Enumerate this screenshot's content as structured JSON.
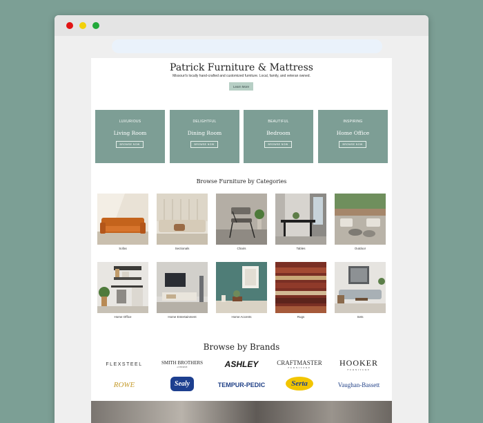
{
  "hero": {
    "title": "Patrick Furniture & Mattress",
    "subtitle": "Missouri's locally hand-crafted and customized furniture. Local, family, and veteran owned.",
    "cta": "Learn More"
  },
  "rooms": [
    {
      "kicker": "LUXURIOUS",
      "title": "Living Room",
      "button": "BROWSE NOW"
    },
    {
      "kicker": "DELIGHTFUL",
      "title": "Dining Room",
      "button": "BROWSE NOW"
    },
    {
      "kicker": "BEAUTIFUL",
      "title": "Bedroom",
      "button": "BROWSE NOW"
    },
    {
      "kicker": "INSPIRING",
      "title": "Home Office",
      "button": "BROWSE NOW"
    }
  ],
  "categories": {
    "title": "Browse Furniture by Categories",
    "items": [
      {
        "label": "Sofas"
      },
      {
        "label": "Sectionals"
      },
      {
        "label": "Chairs"
      },
      {
        "label": "Tables"
      },
      {
        "label": "Outdoor"
      },
      {
        "label": "Home Office"
      },
      {
        "label": "Home Entertainment"
      },
      {
        "label": "Home Accents"
      },
      {
        "label": "Rugs"
      },
      {
        "label": "Sets"
      }
    ]
  },
  "brands": {
    "title": "Browse by Brands",
    "items": [
      {
        "name": "FLEXSTEEL"
      },
      {
        "name": "SMITH BROTHERS",
        "sub": "of BERNE"
      },
      {
        "name": "ASHLEY"
      },
      {
        "name": "CRAFTMASTER",
        "sub": "FURNITURE"
      },
      {
        "name": "HOOKER",
        "sub": "FURNITURE"
      },
      {
        "name": "ROWE"
      },
      {
        "name": "Sealy"
      },
      {
        "name": "TEMPUR-PEDIC"
      },
      {
        "name": "Serta"
      },
      {
        "name": "Vaughan-Bassett"
      }
    ]
  },
  "colors": {
    "page_background": "#7c9f95",
    "card_green": "#7d9e95",
    "button_green": "#b7cfc5"
  }
}
